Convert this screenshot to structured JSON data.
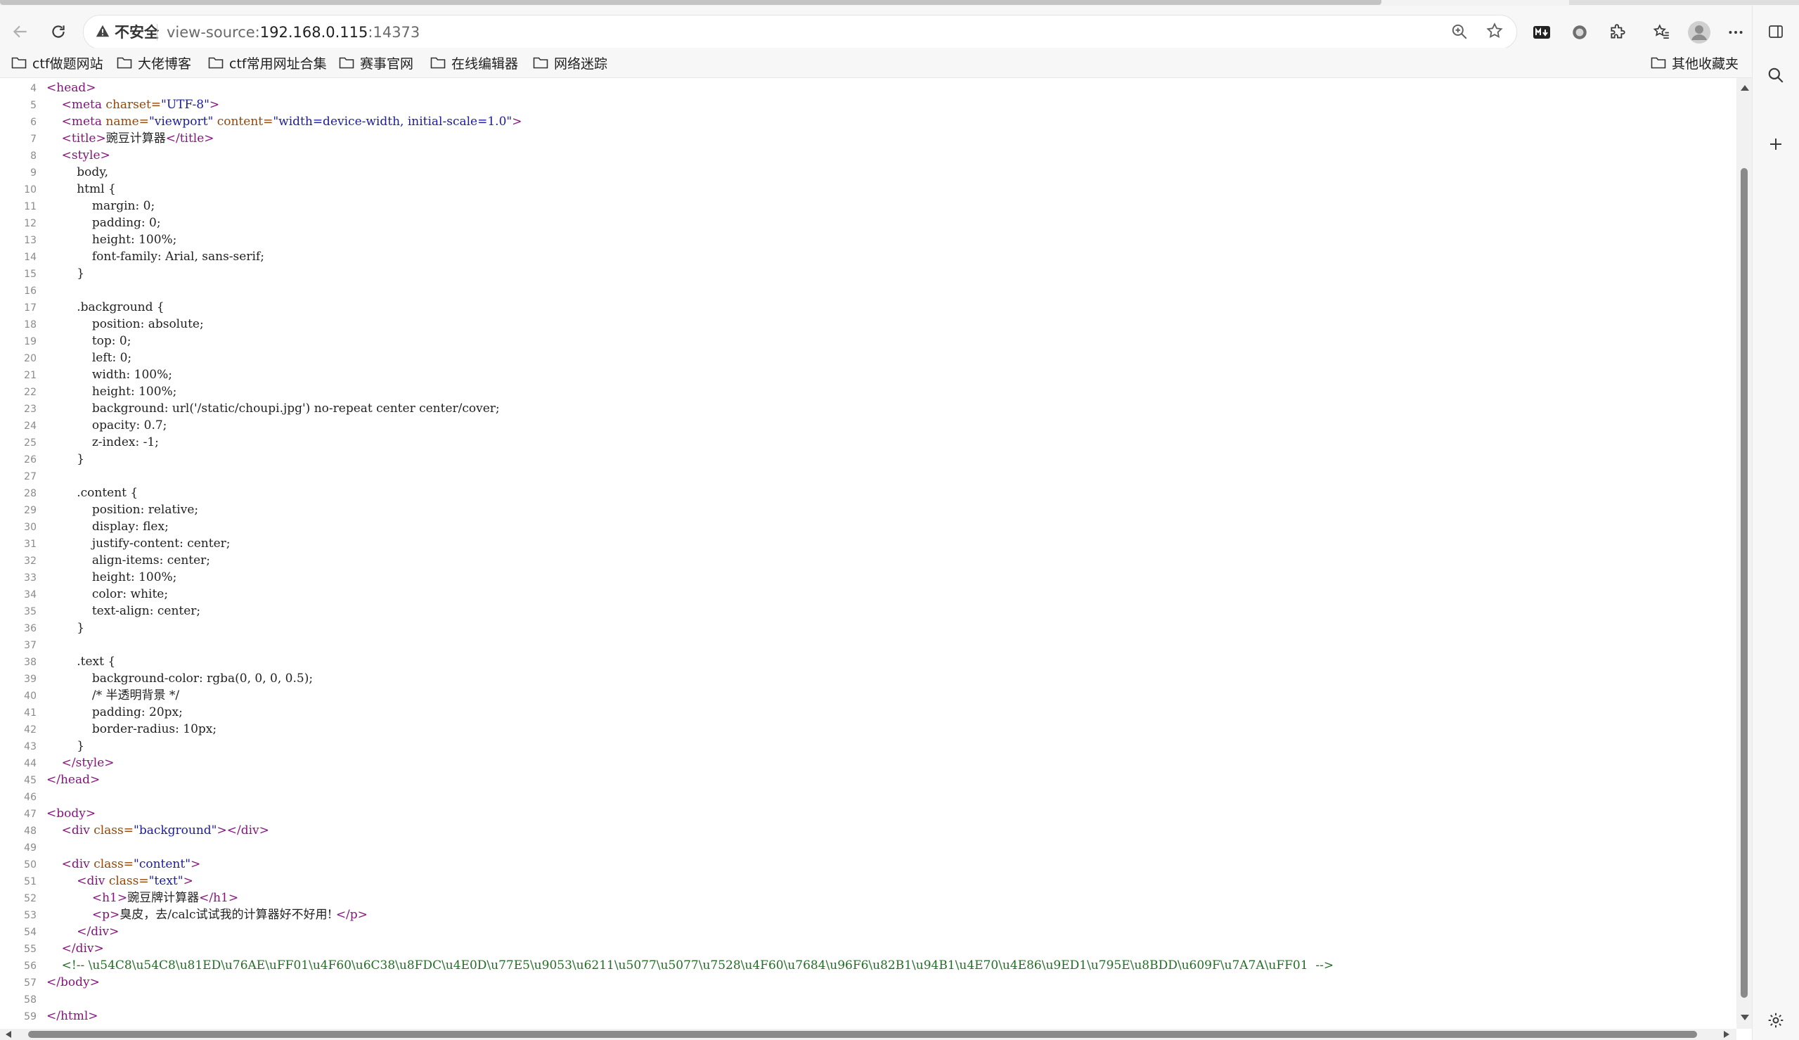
{
  "tabstrip": {},
  "address_bar": {
    "security_label": "不安全",
    "url_prefix": "view-source:",
    "url_host": "192.168.0.115",
    "url_port": ":14373"
  },
  "bookmarks": [
    {
      "label": "ctf做题网站"
    },
    {
      "label": "大佬博客"
    },
    {
      "label": "ctf常用网址合集"
    },
    {
      "label": "赛事官网"
    },
    {
      "label": "在线编辑器"
    },
    {
      "label": "网络迷踪"
    }
  ],
  "other_bookmarks": "其他收藏夹",
  "source_lines": [
    {
      "n": "4",
      "html": "<span class=\"t\">&lt;head&gt;</span>"
    },
    {
      "n": "5",
      "html": "    <span class=\"t\">&lt;meta </span><span class=\"a\">charset=</span><span class=\"v\">\"UTF-8\"</span><span class=\"t\">&gt;</span>"
    },
    {
      "n": "6",
      "html": "    <span class=\"t\">&lt;meta </span><span class=\"a\">name=</span><span class=\"v\">\"viewport\"</span> <span class=\"a\">content=</span><span class=\"v\">\"width=device-width, initial-scale=1.0\"</span><span class=\"t\">&gt;</span>"
    },
    {
      "n": "7",
      "html": "    <span class=\"t\">&lt;title&gt;</span>豌豆计算器<span class=\"t\">&lt;/title&gt;</span>"
    },
    {
      "n": "8",
      "html": "    <span class=\"t\">&lt;style&gt;</span>"
    },
    {
      "n": "9",
      "html": "        body,"
    },
    {
      "n": "10",
      "html": "        html {"
    },
    {
      "n": "11",
      "html": "            margin: 0;"
    },
    {
      "n": "12",
      "html": "            padding: 0;"
    },
    {
      "n": "13",
      "html": "            height: 100%;"
    },
    {
      "n": "14",
      "html": "            font-family: Arial, sans-serif;"
    },
    {
      "n": "15",
      "html": "        }"
    },
    {
      "n": "16",
      "html": ""
    },
    {
      "n": "17",
      "html": "        .background {"
    },
    {
      "n": "18",
      "html": "            position: absolute;"
    },
    {
      "n": "19",
      "html": "            top: 0;"
    },
    {
      "n": "20",
      "html": "            left: 0;"
    },
    {
      "n": "21",
      "html": "            width: 100%;"
    },
    {
      "n": "22",
      "html": "            height: 100%;"
    },
    {
      "n": "23",
      "html": "            background: url('/static/choupi.jpg') no-repeat center center/cover;"
    },
    {
      "n": "24",
      "html": "            opacity: 0.7;"
    },
    {
      "n": "25",
      "html": "            z-index: -1;"
    },
    {
      "n": "26",
      "html": "        }"
    },
    {
      "n": "27",
      "html": ""
    },
    {
      "n": "28",
      "html": "        .content {"
    },
    {
      "n": "29",
      "html": "            position: relative;"
    },
    {
      "n": "30",
      "html": "            display: flex;"
    },
    {
      "n": "31",
      "html": "            justify-content: center;"
    },
    {
      "n": "32",
      "html": "            align-items: center;"
    },
    {
      "n": "33",
      "html": "            height: 100%;"
    },
    {
      "n": "34",
      "html": "            color: white;"
    },
    {
      "n": "35",
      "html": "            text-align: center;"
    },
    {
      "n": "36",
      "html": "        }"
    },
    {
      "n": "37",
      "html": ""
    },
    {
      "n": "38",
      "html": "        .text {"
    },
    {
      "n": "39",
      "html": "            background-color: rgba(0, 0, 0, 0.5);"
    },
    {
      "n": "40",
      "html": "            /* 半透明背景 */"
    },
    {
      "n": "41",
      "html": "            padding: 20px;"
    },
    {
      "n": "42",
      "html": "            border-radius: 10px;"
    },
    {
      "n": "43",
      "html": "        }"
    },
    {
      "n": "44",
      "html": "    <span class=\"t\">&lt;/style&gt;</span>"
    },
    {
      "n": "45",
      "html": "<span class=\"t\">&lt;/head&gt;</span>"
    },
    {
      "n": "46",
      "html": ""
    },
    {
      "n": "47",
      "html": "<span class=\"t\">&lt;body&gt;</span>"
    },
    {
      "n": "48",
      "html": "    <span class=\"t\">&lt;div </span><span class=\"a\">class=</span><span class=\"v\">\"background\"</span><span class=\"t\">&gt;&lt;/div&gt;</span>"
    },
    {
      "n": "49",
      "html": ""
    },
    {
      "n": "50",
      "html": "    <span class=\"t\">&lt;div </span><span class=\"a\">class=</span><span class=\"v\">\"content\"</span><span class=\"t\">&gt;</span>"
    },
    {
      "n": "51",
      "html": "        <span class=\"t\">&lt;div </span><span class=\"a\">class=</span><span class=\"v\">\"text\"</span><span class=\"t\">&gt;</span>"
    },
    {
      "n": "52",
      "html": "            <span class=\"t\">&lt;h1&gt;</span>豌豆牌计算器<span class=\"t\">&lt;/h1&gt;</span>"
    },
    {
      "n": "53",
      "html": "            <span class=\"t\">&lt;p&gt;</span>臭皮，去/calc试试我的计算器好不好用! <span class=\"t\">&lt;/p&gt;</span>"
    },
    {
      "n": "54",
      "html": "        <span class=\"t\">&lt;/div&gt;</span>"
    },
    {
      "n": "55",
      "html": "    <span class=\"t\">&lt;/div&gt;</span>"
    },
    {
      "n": "56",
      "html": "    <span class=\"c\">&lt;!-- \\u54C8\\u54C8\\u81ED\\u76AE\\uFF01\\u4F60\\u6C38\\u8FDC\\u4E0D\\u77E5\\u9053\\u6211\\u5077\\u5077\\u7528\\u4F60\\u7684\\u96F6\\u82B1\\u94B1\\u4E70\\u4E86\\u9ED1\\u795E\\u8BDD\\u609F\\u7A7A\\uFF01  --&gt;</span>"
    },
    {
      "n": "57",
      "html": "<span class=\"t\">&lt;/body&gt;</span>"
    },
    {
      "n": "58",
      "html": ""
    },
    {
      "n": "59",
      "html": "<span class=\"t\">&lt;/html&gt;</span>"
    }
  ],
  "icons": {
    "back": "back-arrow-icon",
    "reload": "reload-icon",
    "warning": "warning-triangle-icon",
    "zoom": "zoom-icon",
    "favorite": "star-icon",
    "markdown": "markdown-icon",
    "record": "record-icon",
    "extensions": "puzzle-icon",
    "favorites": "favorites-icon",
    "profile": "avatar-icon",
    "menu": "more-icon",
    "folder": "folder-icon",
    "search": "search-icon",
    "add": "plus-icon",
    "settings": "gear-icon",
    "sidebar": "sidebar-icon"
  }
}
